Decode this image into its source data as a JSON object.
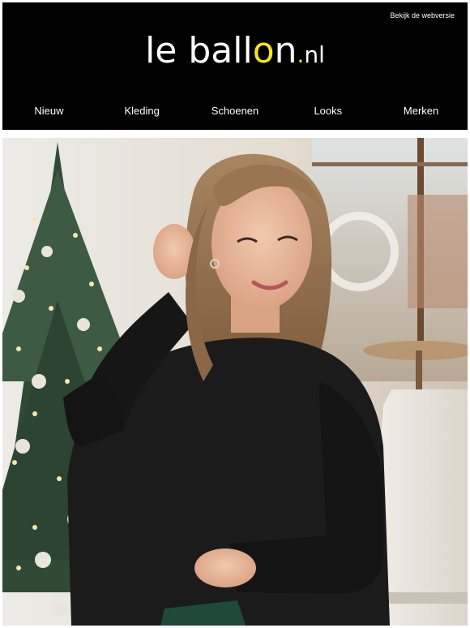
{
  "header": {
    "webversion_link": "Bekijk de webversie",
    "logo": {
      "part1": "le ball",
      "o": "o",
      "part2": "n",
      "dot": ".",
      "tld": "nl"
    }
  },
  "nav": {
    "items": [
      {
        "label": "Nieuw"
      },
      {
        "label": "Kleding"
      },
      {
        "label": "Schoenen"
      },
      {
        "label": "Looks"
      },
      {
        "label": "Merken"
      }
    ]
  },
  "colors": {
    "header_bg": "#000000",
    "accent_yellow": "#f4e61b",
    "text_light": "#ffffff"
  }
}
